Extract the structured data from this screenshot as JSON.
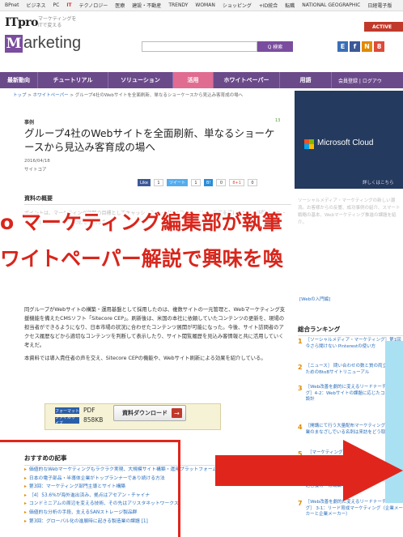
{
  "topbar": {
    "items": [
      "BPnet",
      "ビジネス",
      "PC",
      "IT",
      "テクノロジー",
      "医療",
      "建設・不動産",
      "TRENDY",
      "WOMAN",
      "ショッピング",
      "+ID統合",
      "転職",
      "NATIONAL GEOGRAPHIC",
      "日経電子版"
    ],
    "active_index": 3
  },
  "header": {
    "brand": "ITpro",
    "tagline_line1": "マーケティングを",
    "tagline_line2": "ITで変える",
    "logo_m": "M",
    "logo_rest": "arketing",
    "search_button": "Q 検索",
    "partner_logo": "ACTIVE",
    "social": [
      "E",
      "f",
      "N",
      "8"
    ]
  },
  "nav": {
    "items": [
      "最新動向",
      "チュートリアル",
      "ソリューション",
      "活用",
      "ホワイトペーパー",
      "用語"
    ],
    "active_index": 3,
    "login": "会員登録 | ログアウ"
  },
  "breadcrumb": {
    "home": "トップ",
    "sep1": " > ",
    "section": "ホワイトペーパー",
    "sep2": " > ",
    "current": "グループ4社のWebサイトを全面刷新、単なるショーケースから見込み客育成の場へ"
  },
  "article": {
    "category": "事例",
    "new_mark": "13",
    "title": "グループ4社のWebサイトを全面刷新、単なるショーケースから見込み客育成の場へ",
    "date": "2016/04/18",
    "author": "サイトコア",
    "share": [
      {
        "label": "Like",
        "count": "1"
      },
      {
        "label": "ツイート",
        "count": "1"
      },
      {
        "label": "B!",
        "count": "0"
      },
      {
        "label": "8+1",
        "count": "0"
      }
    ],
    "summary_heading": "資料の概要",
    "summary_faded": "ポイントは、マーケティング部門の目標としてキャッシュフロー創出とコンバージョン改善を掲げ、サイト訪問者のニーズに応じたコンテンツ配信を実現した。",
    "para1": "同グループがWebサイトの構築・運用基盤として採用したのは、複数サイトの一元管理と、Webマーケティング支援機能を備えたCMSソフト「Sitecore CEP」。刷新後は、米国の本社に依頼していたコンテンツの更新を、現場の担当者ができるようになり、日本市場の状況に合わせたコンテンツ展開が可能になった。今後、サイト訪問者のアクセス履歴などから適切なコンテンツを判断して表示したり、サイト閲覧履歴を見込み客情報と共に活用していく考えだ。",
    "para2": "本資料では導入責任者の声を交え、Sitecore CEPの機能や、Webサイト刷新による効果を紹介している。",
    "download": {
      "format_label": "フォーマット",
      "format_value": "PDF",
      "size_label": "ファイルサイズ",
      "size_value": "858KB",
      "button": "資料ダウンロード",
      "icon": "→"
    }
  },
  "recommended": {
    "heading": "おすすめの記事",
    "items": [
      "価値的なWebマーケティングもラクラク実現、大規模サイト構築・運用プラットフォーム",
      "日本の電子部品・半導体企業がトップランナーであり続ける方法",
      "第3回：マーケティング部門主導とサイト構築",
      "［4］53.6%が海外進出済み、拠点はアセアン・チャイナ",
      "コンドミニアムの周辺を変える技術、その先はアリスタネットワークス",
      "価値的な分析の手段、支えるSANストレージ製品群",
      "第3回：グローバル化の進展時に起きる製造業の課題 [1]"
    ]
  },
  "sidebar": {
    "ad_brand": "Microsoft Cloud",
    "ad_more": "詳しくはこちら",
    "faded": "ソーシャルメディア・マーケティングの新しい潮流。お客様からの反響、成功事例の紹介、スマート戦略の基本、Webマーケティング推進の課題を紹介。",
    "extra_link": "[Webの入門編]",
    "ranking_heading": "総合ランキング",
    "ranking": [
      {
        "num": "1",
        "text": "［ソーシャルメディア・マーケティング］第1回 今さら聞けない Pinterestの使い方"
      },
      {
        "num": "2",
        "text": "［ニュース］ 問い合わせの数と質の両立を図るためのBtoBサイトリニューアル"
      },
      {
        "num": "3",
        "text": "［Web改善を劇的に変えるリードナーチャリング］4-2：Webサイトの課題に応じたコンテンツ設計"
      },
      {
        "num": "4",
        "text": "［開講にて行う大量配布マーケティング］ 大企業のまなざしでいる名刺は来訪をどう取る"
      },
      {
        "num": "5",
        "text": "［マーケティング］"
      },
      {
        "num": "6",
        "text": "［Web改善を劇的に変えるリードナーチャリング］ 3-3：リード育成マーケティング（中堅）見込客獲得・育成編"
      },
      {
        "num": "7",
        "text": "［Web改善を劇的に変えるリードナーチャリング］ 3-1：リード育成マーケティング（企業メーカーと企業メーカー）"
      }
    ]
  },
  "overlay": {
    "line1": "o マーケティング編集部が執筆",
    "line2": "ワイトペーパー解説で興味を喚"
  },
  "colors": {
    "brand_purple": "#6b4a8a",
    "nav_active": "#e06c92",
    "overlay_red": "#d8261c",
    "link_blue": "#2a6ebb",
    "ad_bg": "#243a5e"
  }
}
